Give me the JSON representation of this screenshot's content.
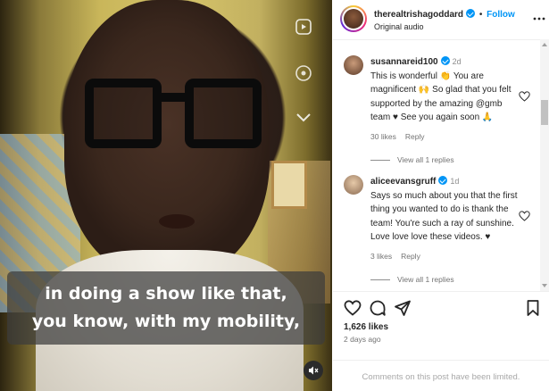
{
  "video": {
    "caption_lines": [
      "in doing a show like that,",
      "you know, with my mobility,"
    ]
  },
  "post": {
    "username": "therealtrishagoddard",
    "separator": "•",
    "follow_label": "Follow",
    "audio_label": "Original audio"
  },
  "comments": [
    {
      "username": "susannareid100",
      "time": "2d",
      "text": "This is wonderful 👏 You are magnificent 🙌 So glad that you felt supported by the amazing @gmb team ♥ See you again soon 🙏",
      "likes": "30 likes",
      "reply_label": "Reply",
      "view_replies": "View all 1 replies"
    },
    {
      "username": "aliceevansgruff",
      "time": "1d",
      "text": "Says so much about you that the first thing you wanted to do is thank the team! You're such a ray of sunshine. Love love love these videos. ♥",
      "likes": "3 likes",
      "reply_label": "Reply",
      "view_replies": "View all 1 replies"
    }
  ],
  "actions": {
    "likes_count": "1,626 likes",
    "posted_ago": "2 days ago",
    "comments_limited": "Comments on this post have been limited."
  },
  "colors": {
    "accent": "#0095f6",
    "text": "#262626",
    "muted": "#737373",
    "heart": "#ed4956"
  }
}
